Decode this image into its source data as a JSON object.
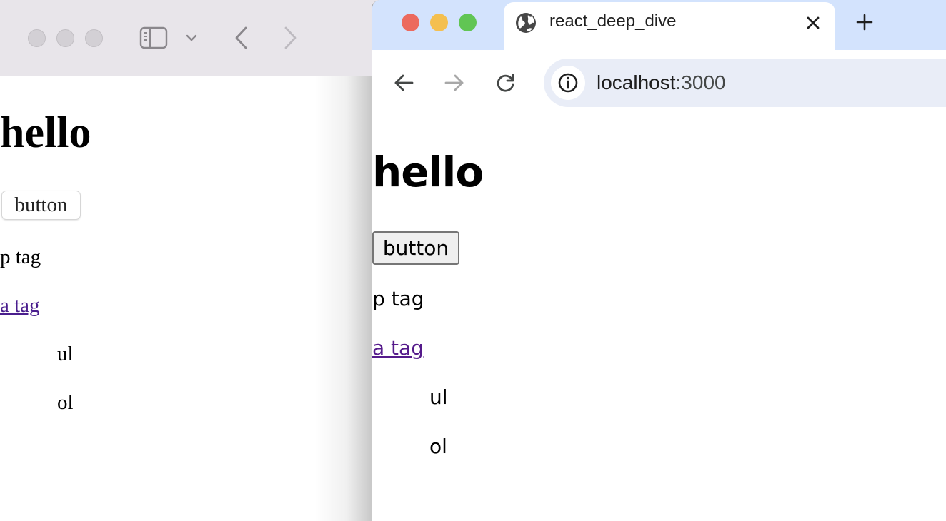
{
  "left_window": {
    "page": {
      "heading": "hello",
      "button_label": "button",
      "paragraph": "p tag",
      "link": "a tag",
      "ul_item": "ul",
      "ol_item": "ol"
    }
  },
  "right_window": {
    "tab": {
      "title": "react_deep_dive",
      "favicon": "globe-icon"
    },
    "address_bar": {
      "host": "localhost",
      "port": ":3000"
    },
    "page": {
      "heading": "hello",
      "button_label": "button",
      "paragraph": "p tag",
      "link": "a tag",
      "ul_item": "ul",
      "ol_item": "ol"
    }
  },
  "icons": {
    "safari_sidebar": "sidebar-icon",
    "safari_chevron": "chevron-down-icon",
    "back": "back-arrow-icon",
    "forward": "forward-arrow-icon",
    "reload": "reload-icon",
    "info": "info-icon",
    "close": "close-icon",
    "new_tab": "plus-icon"
  },
  "colors": {
    "traffic_close": "#ec6a5e",
    "traffic_minimize": "#f4bf4f",
    "traffic_maximize": "#61c554",
    "visited_link": "#551a8b",
    "tabstrip": "#d3e3fd",
    "omnibox": "#e9edf7"
  }
}
